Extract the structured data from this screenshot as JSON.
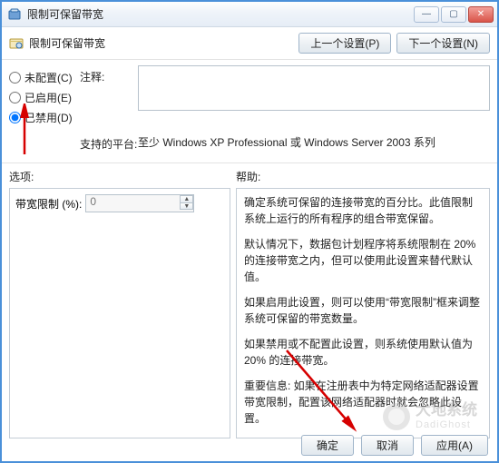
{
  "window": {
    "title": "限制可保留带宽"
  },
  "header": {
    "title": "限制可保留带宽",
    "prev_btn": "上一个设置(P)",
    "next_btn": "下一个设置(N)"
  },
  "config": {
    "radios": {
      "not_configured": "未配置(C)",
      "enabled": "已启用(E)",
      "disabled": "已禁用(D)",
      "selected": "disabled"
    },
    "comment_label": "注释:",
    "platform_label": "支持的平台:",
    "platform_value": "至少 Windows XP Professional 或 Windows Server 2003 系列"
  },
  "sections": {
    "options_label": "选项:",
    "help_label": "帮助:"
  },
  "options": {
    "bandwidth_label": "带宽限制 (%):",
    "bandwidth_value": "0"
  },
  "help": {
    "p1": "确定系统可保留的连接带宽的百分比。此值限制系统上运行的所有程序的组合带宽保留。",
    "p2": "默认情况下，数据包计划程序将系统限制在 20% 的连接带宽之内，但可以使用此设置来替代默认值。",
    "p3": "如果启用此设置，则可以使用“带宽限制”框来调整系统可保留的带宽数量。",
    "p4": "如果禁用或不配置此设置，则系统使用默认值为 20% 的连接带宽。",
    "p5": "重要信息: 如果在注册表中为特定网络适配器设置带宽限制，配置该网络适配器时就会忽略此设置。"
  },
  "footer": {
    "ok": "确定",
    "cancel": "取消",
    "apply": "应用(A)"
  },
  "watermark": {
    "cn": "大地系统",
    "en": "DadiGhost"
  }
}
